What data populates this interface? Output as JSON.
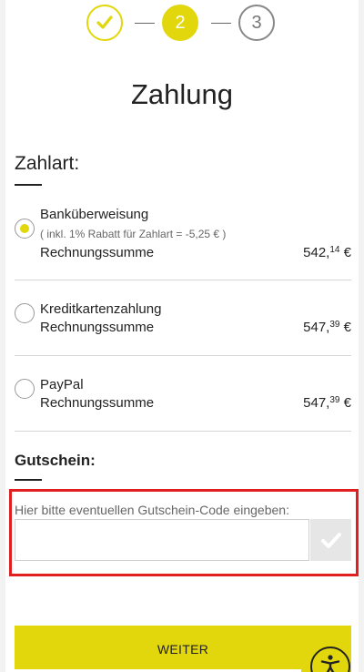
{
  "steps": {
    "done_icon": "check-icon",
    "current": "2",
    "next": "3"
  },
  "page_title": "Zahlung",
  "payment": {
    "heading": "Zahlart:",
    "options": [
      {
        "name": "Banküberweisung",
        "note": "( inkl. 1% Rabatt für Zahlart = -5,25 € )",
        "sum_label": "Rechnungssumme",
        "sum_main": "542,",
        "sum_cents": "14",
        "currency": " €",
        "selected": true
      },
      {
        "name": "Kreditkartenzahlung",
        "sum_label": "Rechnungssumme",
        "sum_main": "547,",
        "sum_cents": "39",
        "currency": " €",
        "selected": false
      },
      {
        "name": "PayPal",
        "sum_label": "Rechnungssumme",
        "sum_main": "547,",
        "sum_cents": "39",
        "currency": " €",
        "selected": false
      }
    ]
  },
  "voucher": {
    "heading": "Gutschein:",
    "label": "Hier bitte eventuellen Gutschein-Code eingeben:",
    "value": "",
    "submit_icon": "check-icon"
  },
  "cta": {
    "label": "WEITER"
  },
  "accessibility": {
    "icon": "accessibility-person-icon"
  },
  "colors": {
    "accent": "#e1d70c",
    "highlight": "#e02020"
  }
}
